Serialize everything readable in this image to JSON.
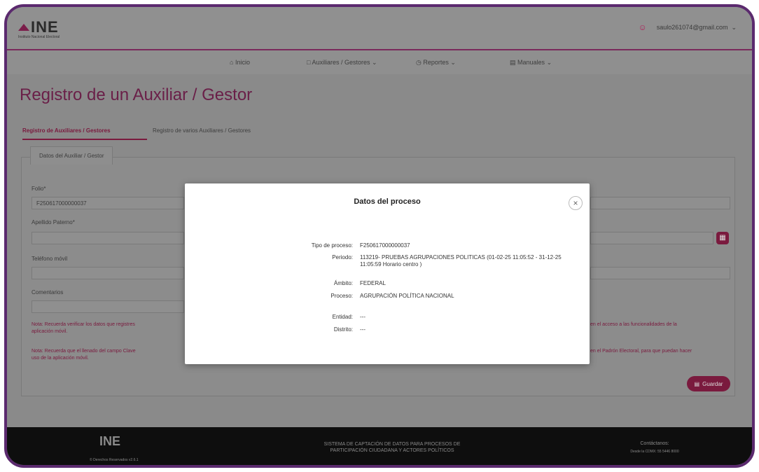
{
  "header": {
    "logo": "INE",
    "logo_sub": "Instituto Nacional Electoral",
    "user_email": "saulo261074@gmail.com"
  },
  "nav": {
    "items": [
      "Inicio",
      "Auxiliares / Gestores",
      "Reportes",
      "Manuales"
    ]
  },
  "page": {
    "title": "Registro de un Auxiliar / Gestor",
    "tabs": [
      "Registro de Auxiliares / Gestores",
      "Registro de varios Auxiliares / Gestores"
    ],
    "panel_tab": "Datos del Auxiliar / Gestor",
    "fields": {
      "folio_label": "Folio*",
      "folio_value": "F250617000000037",
      "apellido_label": "Apellido Paterno*",
      "telefono_label": "Teléfono móvil",
      "comentarios_label": "Comentarios"
    },
    "notes": {
      "note1_left": "Nota: Recuerda verificar los datos que registres",
      "note1_left2": "aplicación móvil.",
      "note1_right": "en el acceso a las funcionalidades de la",
      "note2_left": "Nota: Recuerda que el llenado del campo Clave",
      "note2_left2": "uso de la aplicación móvil.",
      "note2_right": "en el Padrón Electoral, para que puedan hacer"
    },
    "save_label": "Guardar"
  },
  "modal": {
    "title": "Datos del proceso",
    "rows": [
      {
        "label": "Tipo de proceso:",
        "value": "F250617000000037"
      },
      {
        "label": "Periodo:",
        "value": "113219- PRUEBAS AGRUPACIONES POLITICAS (01-02-25 11:05:52 - 31-12-25 11:05:59 Horario centro )"
      },
      {
        "label": "Ámbito:",
        "value": "FEDERAL"
      },
      {
        "label": "Proceso:",
        "value": "AGRUPACIÓN POLÍTICA NACIONAL"
      },
      {
        "label": "Entidad:",
        "value": "---"
      },
      {
        "label": "Distrito:",
        "value": "---"
      }
    ]
  },
  "footer": {
    "logo": "INE",
    "sub": "© Derechos Reservados v2.6.1",
    "center_line1": "SISTEMA DE CAPTACIÓN DE DATOS PARA PROCESOS DE",
    "center_line2": "PARTICIPACIÓN CIUDADANA Y ACTORES POLÍTICOS",
    "contact_title": "Contáctanos:",
    "contact_sub": "Desde la CDMX: 55 5446 8000"
  },
  "colors": {
    "accent": "#7a1a3e",
    "frame": "#5b2a6e"
  }
}
